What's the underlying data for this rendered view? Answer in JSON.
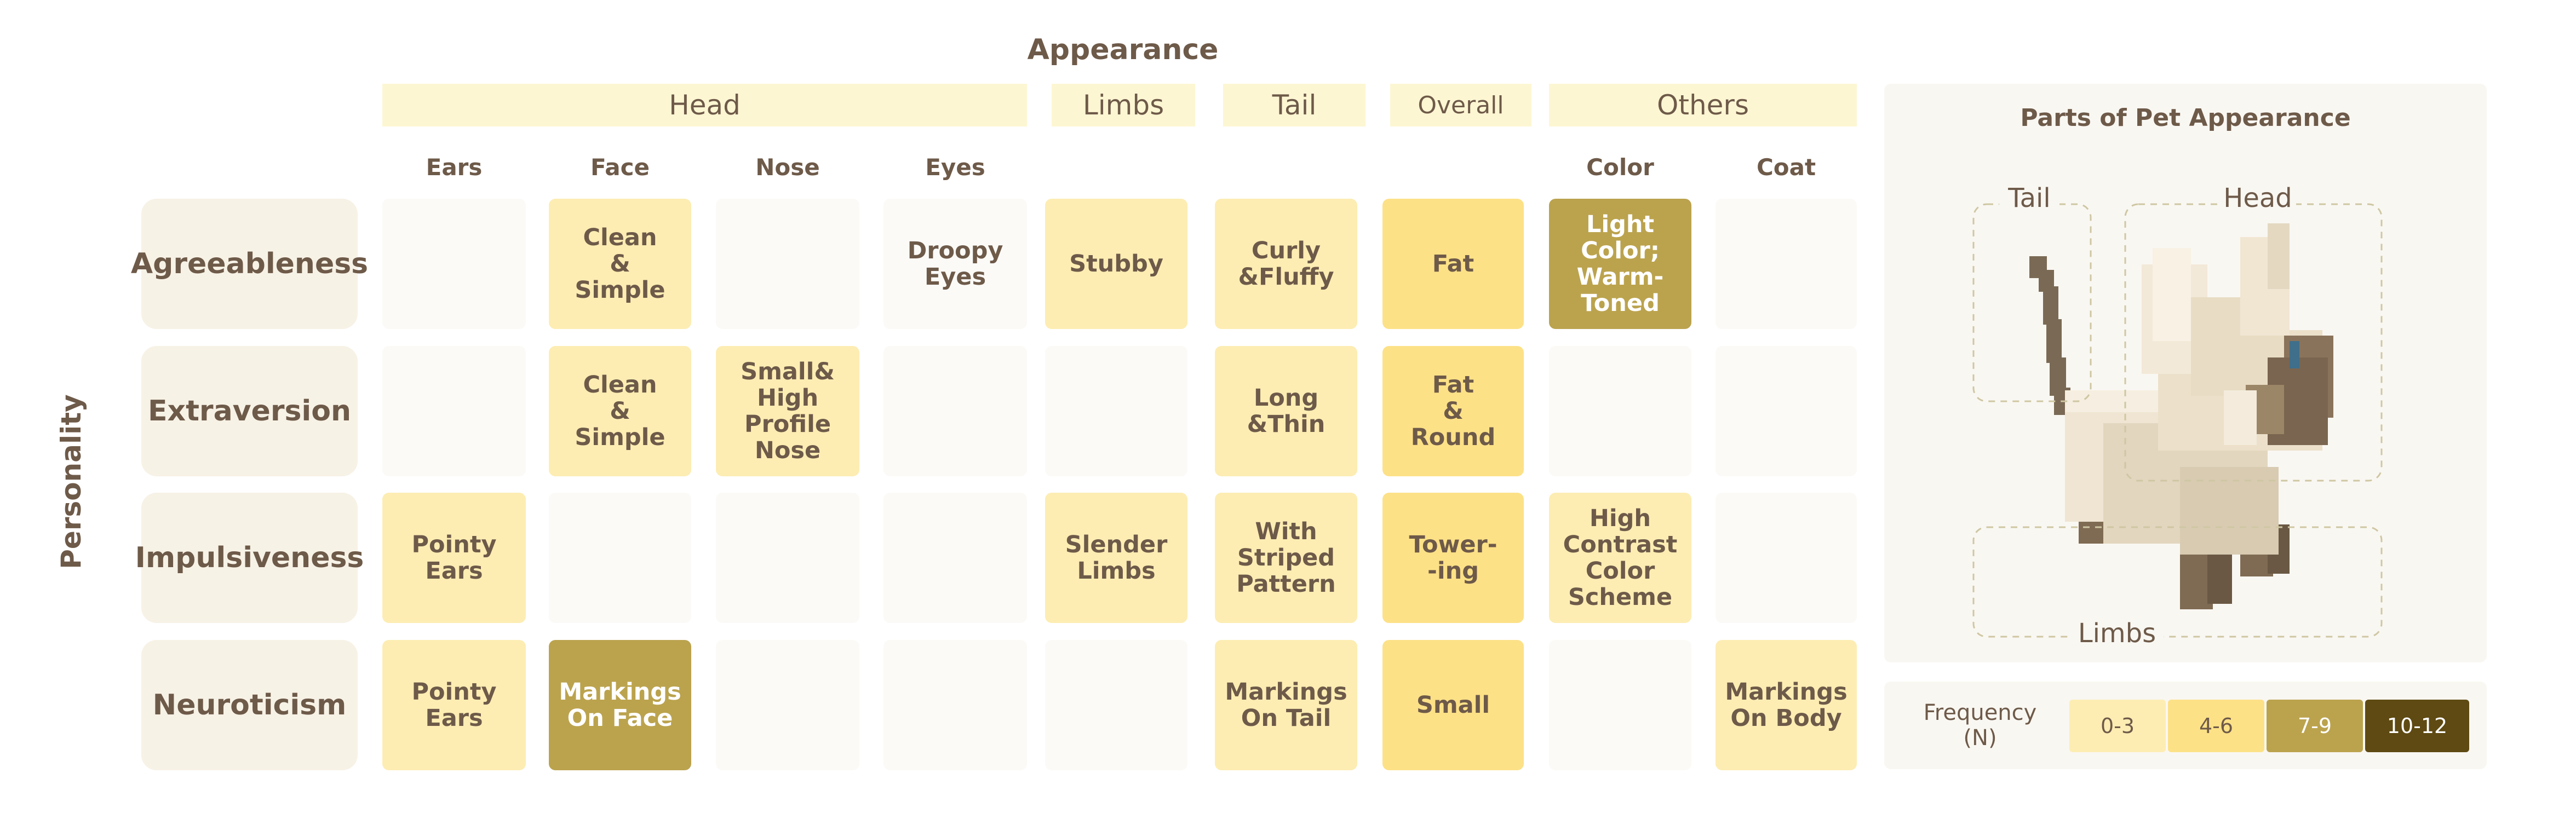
{
  "appearance_title": "Appearance",
  "personality_title": "Personality",
  "groups": {
    "head": "Head",
    "limbs": "Limbs",
    "tail": "Tail",
    "overall": "Overall",
    "others": "Others"
  },
  "columns": {
    "ears": "Ears",
    "face": "Face",
    "nose": "Nose",
    "eyes": "Eyes",
    "color": "Color",
    "coat": "Coat"
  },
  "rows": {
    "agreeableness": "Agreeableness",
    "extraversion": "Extraversion",
    "impulsiveness": "Impulsiveness",
    "neuroticism": "Neuroticism"
  },
  "cells": {
    "agreeableness": {
      "face": "Clean\n&\nSimple",
      "eyes": "Droopy\nEyes",
      "limbs": "Stubby",
      "tail": "Curly\n&Fluffy",
      "overall": "Fat",
      "color": "Light\nColor;\nWarm-\nToned"
    },
    "extraversion": {
      "face": "Clean\n&\nSimple",
      "nose": "Small&\nHigh\nProfile\nNose",
      "tail": "Long\n&Thin",
      "overall": "Fat\n&\nRound"
    },
    "impulsiveness": {
      "ears": "Pointy\nEars",
      "limbs": "Slender\nLimbs",
      "tail": "With\nStriped\nPattern",
      "overall": "Tower-\n-ing",
      "color": "High\nContrast\nColor\nScheme"
    },
    "neuroticism": {
      "ears": "Pointy\nEars",
      "face": "Markings\nOn Face",
      "tail": "Markings\nOn Tail",
      "overall": "Small",
      "coat": "Markings\nOn Body"
    }
  },
  "panel": {
    "title": "Parts of Pet Appearance",
    "tail_label": "Tail",
    "head_label": "Head",
    "limbs_label": "Limbs"
  },
  "legend": {
    "title": "Frequency (N)",
    "bins": [
      "0-3",
      "4-6",
      "7-9",
      "10-12"
    ],
    "colors": [
      "#fdedb3",
      "#fde187",
      "#bba34e",
      "#5e4a12"
    ]
  }
}
